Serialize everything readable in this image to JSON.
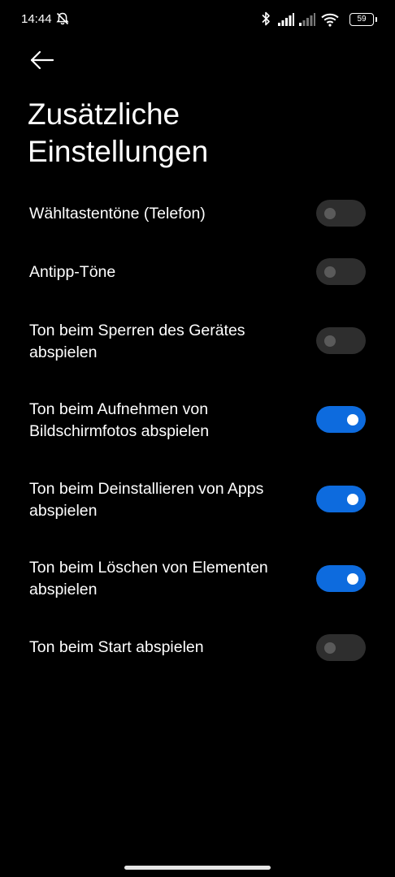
{
  "status_bar": {
    "time": "14:44",
    "battery": "59",
    "icons": [
      "alarm-off-icon",
      "bluetooth-icon",
      "signal-icon",
      "signal-weak-icon",
      "wifi-icon",
      "battery-icon"
    ]
  },
  "header": {
    "back_icon": "arrow-left-icon",
    "title_line1": "Zusätzliche",
    "title_line2": "Einstellungen"
  },
  "settings": [
    {
      "line1": "Wähltastentöne (Telefon)",
      "line2": "",
      "enabled": false
    },
    {
      "line1": "Antipp-Töne",
      "line2": "",
      "enabled": false
    },
    {
      "line1": "Ton beim Sperren des Gerätes",
      "line2": "abspielen",
      "enabled": false
    },
    {
      "line1": "Ton beim Aufnehmen von",
      "line2": "Bildschirmfotos abspielen",
      "enabled": true
    },
    {
      "line1": "Ton beim Deinstallieren von Apps",
      "line2": "abspielen",
      "enabled": true
    },
    {
      "line1": "Ton beim Löschen von Elementen",
      "line2": "abspielen",
      "enabled": true
    },
    {
      "line1": "Ton beim Start abspielen",
      "line2": "",
      "enabled": false
    }
  ],
  "colors": {
    "background": "#000000",
    "toggle_on": "#0d6bde",
    "toggle_off": "#2e2e2e"
  }
}
